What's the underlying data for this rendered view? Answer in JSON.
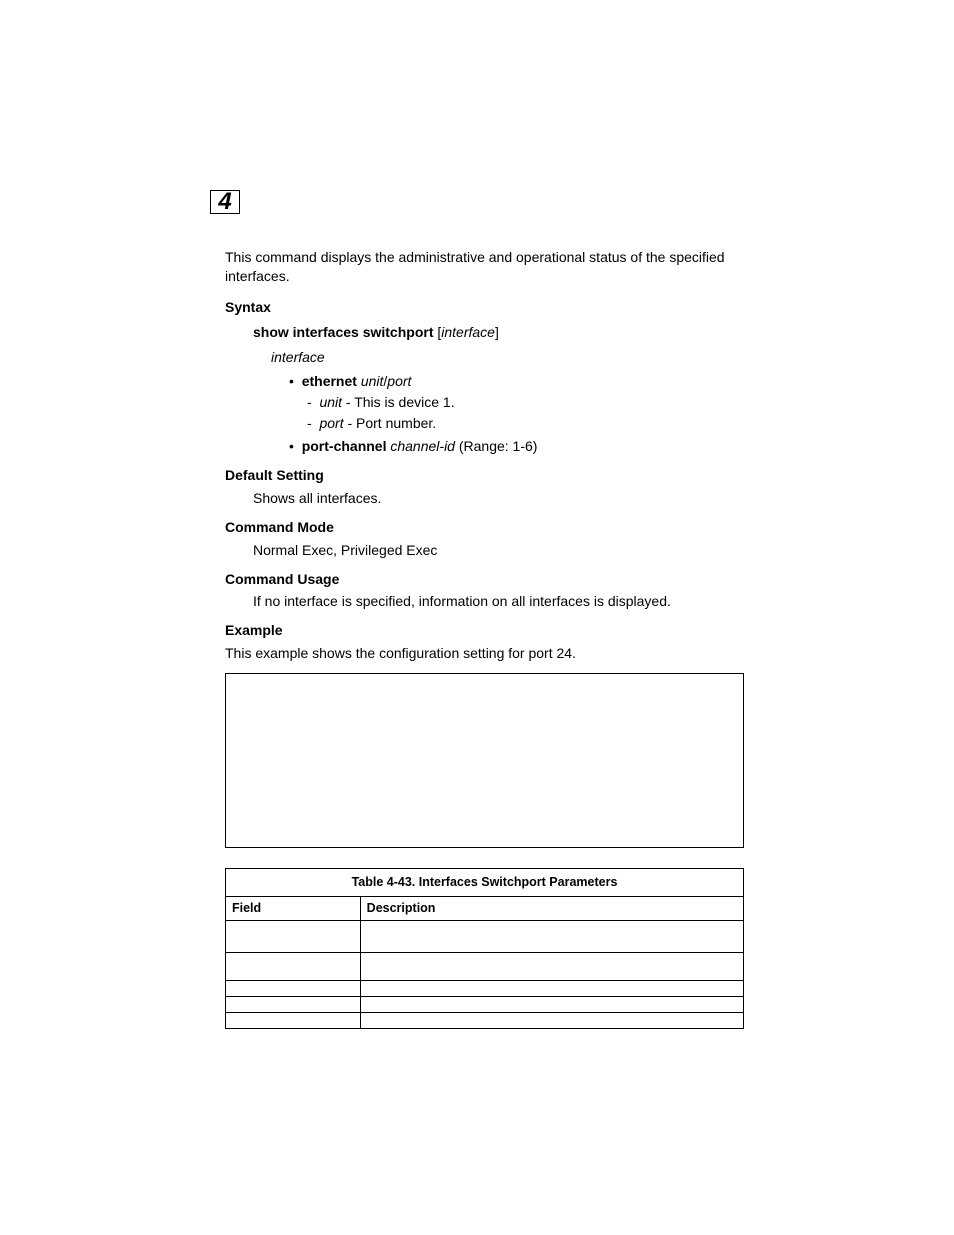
{
  "chapter": {
    "number": "4"
  },
  "intro": "This command displays the administrative and operational status of the specified interfaces.",
  "syntax": {
    "label": "Syntax",
    "cmd_bold": "show interfaces switchport",
    "cmd_bracket_open": " [",
    "cmd_ital": "interface",
    "cmd_bracket_close": "]",
    "interface_label": "interface",
    "eth_bullet_bold": "ethernet",
    "eth_bullet_ital1": "unit",
    "eth_bullet_slash": "/",
    "eth_bullet_ital2": "port",
    "eth_sub1_ital": "unit",
    "eth_sub1_text": " - This is device 1.",
    "eth_sub2_ital": "port",
    "eth_sub2_text": " - Port number.",
    "pc_bold": "port-channel",
    "pc_ital": "channel-id",
    "pc_text": " (Range: 1-6)"
  },
  "default_setting": {
    "label": "Default Setting",
    "text": "Shows all interfaces."
  },
  "command_mode": {
    "label": "Command Mode",
    "text": "Normal Exec, Privileged Exec"
  },
  "command_usage": {
    "label": "Command Usage",
    "text": "If no interface is specified, information on all interfaces is displayed."
  },
  "example": {
    "label": "Example",
    "text": "This example shows the configuration setting for port 24."
  },
  "table": {
    "caption": "Table 4-43.  Interfaces Switchport Parameters",
    "col_field": "Field",
    "col_desc": "Description",
    "rows": [
      {
        "field": "",
        "desc": ""
      },
      {
        "field": "",
        "desc": ""
      },
      {
        "field": "",
        "desc": ""
      },
      {
        "field": "",
        "desc": ""
      },
      {
        "field": "",
        "desc": ""
      }
    ]
  }
}
